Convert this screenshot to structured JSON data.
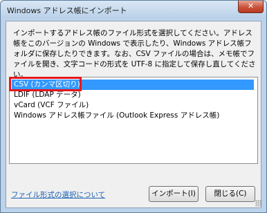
{
  "window": {
    "title": "Windows アドレス帳にインポート",
    "close_glyph": "✕"
  },
  "description": "インポートするアドレス帳のファイル形式を選択してください。アドレス帳をこのバージョンの Windows で表示したり、Windows アドレス帳フォルダに保存したりできます。なお、CSV ファイルの場合は、メモ帳でファイルを開き、文字コードの形式を UTF-8 に指定して保存し直してください。",
  "format_list": {
    "items": [
      {
        "label": "CSV (カンマ区切り)",
        "selected": true
      },
      {
        "label": "LDIF (LDAP データ)",
        "selected": false
      },
      {
        "label": "vCard (VCF ファイル)",
        "selected": false
      },
      {
        "label": "Windows アドレス帳ファイル (Outlook Express アドレス帳)",
        "selected": false
      }
    ]
  },
  "footer": {
    "help_link": "ファイル形式の選択について",
    "import_button": "インポート(I)",
    "close_button": "閉じる(C)"
  },
  "colors": {
    "selection": "#3399ff",
    "highlight_border": "#e8161d",
    "link": "#1a5fb4"
  }
}
